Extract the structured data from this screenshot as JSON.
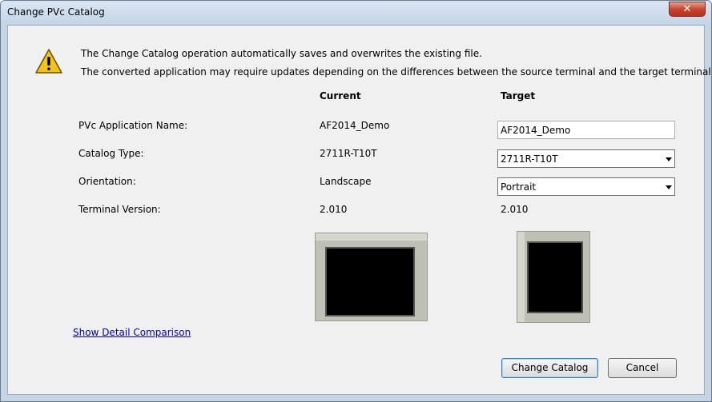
{
  "window": {
    "title": "Change PVc Catalog"
  },
  "message": {
    "line1": "The Change Catalog operation automatically saves and overwrites the existing file.",
    "line2": "The converted application may require updates depending on the differences between the source terminal and the target terminal."
  },
  "columns": {
    "current": "Current",
    "target": "Target"
  },
  "rows": {
    "app_name": {
      "label": "PVc Application Name:",
      "current": "AF2014_Demo",
      "target": "AF2014_Demo"
    },
    "catalog_type": {
      "label": "Catalog Type:",
      "current": "2711R-T10T",
      "target": "2711R-T10T"
    },
    "orientation": {
      "label": "Orientation:",
      "current": "Landscape",
      "target": "Portrait"
    },
    "terminal_version": {
      "label": "Terminal Version:",
      "current": "2.010",
      "target": "2.010"
    }
  },
  "link": {
    "detail_comparison": "Show Detail Comparison"
  },
  "buttons": {
    "change_catalog": "Change Catalog",
    "cancel": "Cancel"
  },
  "icons": {
    "close": "close-icon",
    "warning": "warning-icon",
    "dropdown": "chevron-down-icon"
  },
  "colors": {
    "link": "#0000cc",
    "close_button": "#c6452f",
    "warning_fill": "#f3c417"
  }
}
